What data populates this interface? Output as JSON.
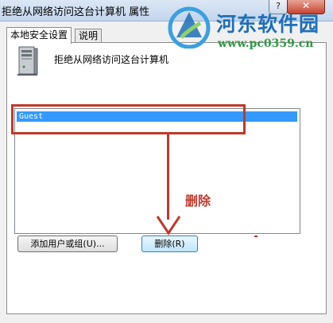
{
  "window": {
    "title": "拒绝从网络访问这台计算机 属性",
    "help_label": "?",
    "close_label": "✕"
  },
  "tabs": [
    {
      "label": "本地安全设置",
      "active": true
    },
    {
      "label": "说明",
      "active": false
    }
  ],
  "policy": {
    "name": "拒绝从网络访问这台计算机",
    "icon": "server-icon"
  },
  "list": {
    "items": [
      {
        "label": "Guest",
        "selected": true
      }
    ]
  },
  "buttons": {
    "add_label": "添加用户或组(U)...",
    "remove_label": "删除(R)"
  },
  "annotation": {
    "text": "删除",
    "color": "#c0392b"
  },
  "watermark": {
    "title": "河东软件园",
    "url": "www.pc0359.cn"
  },
  "colors": {
    "selection": "#3399ff",
    "title_bar": "#c3d5ec",
    "close_button": "#c7442f"
  }
}
